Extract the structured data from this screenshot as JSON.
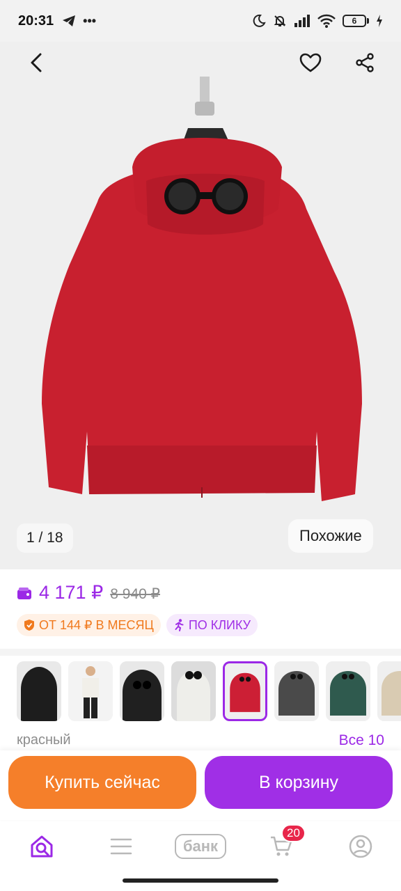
{
  "status_bar": {
    "time": "20:31",
    "battery": "6"
  },
  "gallery": {
    "counter": "1 / 18",
    "similar_label": "Похожие"
  },
  "price": {
    "current": "4 171 ₽",
    "old": "8 940 ₽",
    "accent_color": "#9b28e6"
  },
  "badges": {
    "installment": "ОТ 144 ₽ В МЕСЯЦ",
    "click": "ПО КЛИКУ"
  },
  "variants": {
    "selected_color": "красный",
    "all_label": "Все 10",
    "items": [
      {
        "color": "black",
        "fill": "#1d1d1d"
      },
      {
        "color": "white",
        "fill": "#f1efe9"
      },
      {
        "color": "black",
        "fill": "#202020"
      },
      {
        "color": "white",
        "fill": "#eeeeea"
      },
      {
        "color": "red",
        "fill": "#cc1f35"
      },
      {
        "color": "grey",
        "fill": "#4a4a4a"
      },
      {
        "color": "green",
        "fill": "#2f5a4e"
      },
      {
        "color": "beige",
        "fill": "#d9cbb2"
      }
    ]
  },
  "actions": {
    "buy_label": "Купить сейчас",
    "cart_label": "В корзину",
    "buy_color": "#f57f2a",
    "cart_color": "#a02fe6"
  },
  "bottom_nav": {
    "bank_label": "банк",
    "cart_count": "20"
  }
}
